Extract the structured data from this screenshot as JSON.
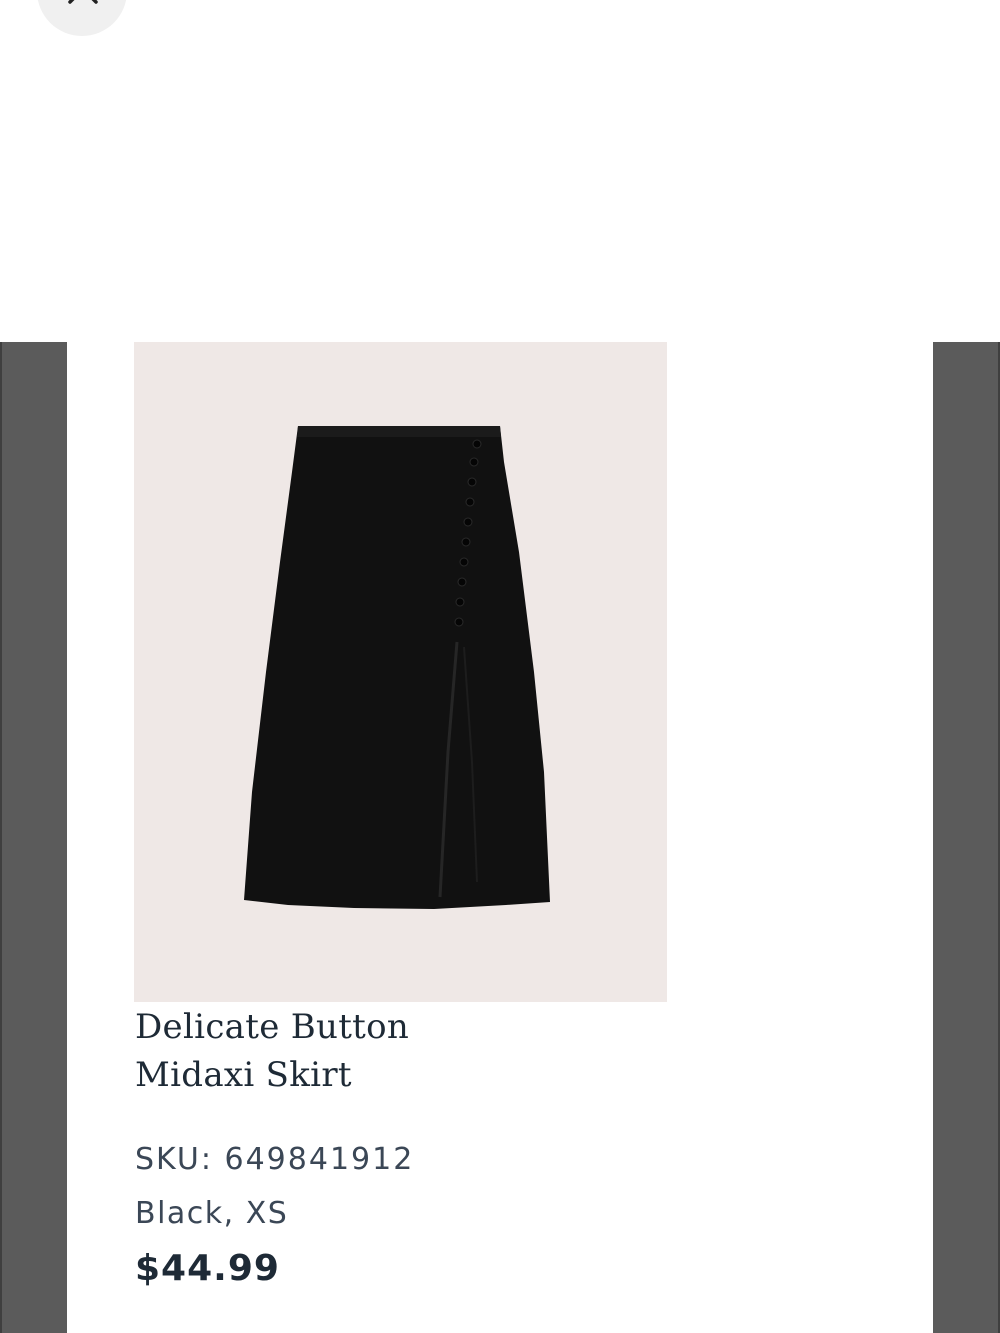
{
  "header": {
    "close_icon": "close-icon"
  },
  "product": {
    "image_icon": "skirt-image",
    "title_line1": "Delicate Button",
    "title_line2": "Midaxi Skirt",
    "sku": "SKU: 649841912",
    "variant": "Black, XS",
    "price": "$44.99"
  },
  "colors": {
    "image_background": "#efe8e6",
    "skirt": "#111111",
    "side_panel": "#5b5b5b",
    "text_dark": "#1e2a36",
    "text_muted": "#3b4756"
  }
}
